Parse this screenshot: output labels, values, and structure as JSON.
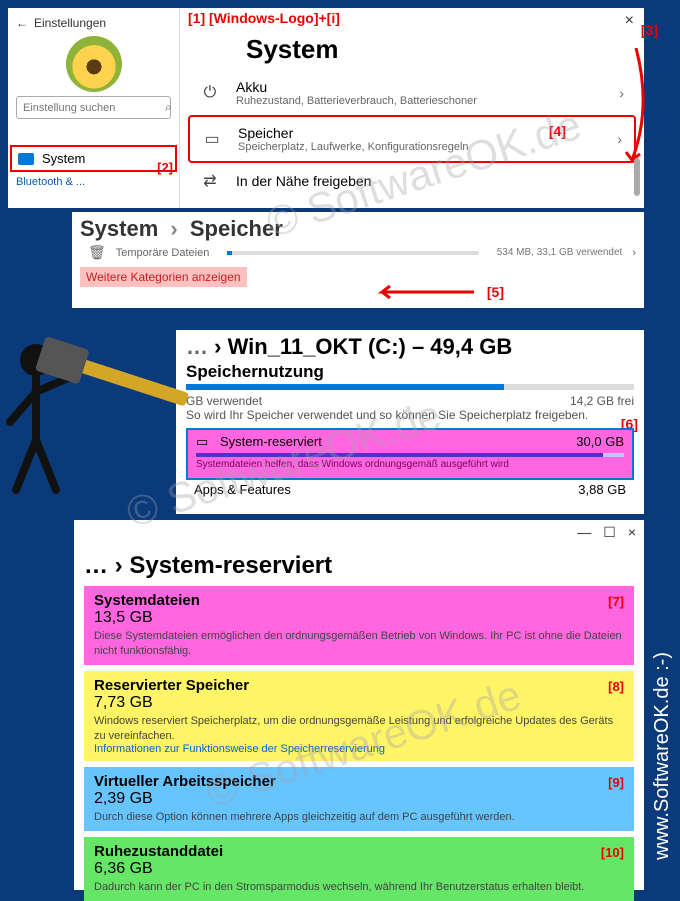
{
  "annotations": {
    "a1": "[1] [Windows-Logo]+[i]",
    "a2": "[2]",
    "a3": "[3]",
    "a4": "[4]",
    "a5": "[5]",
    "a6": "[6]",
    "a7": "[7]",
    "a8": "[8]",
    "a9": "[9]",
    "a10": "[10]"
  },
  "sidebar": {
    "back_label": "Einstellungen",
    "search_placeholder": "Einstellung suchen",
    "nav_system": "System",
    "nav_bt_stub": "Bluetooth & ..."
  },
  "main1": {
    "title": "System",
    "close": "×",
    "akku": {
      "title": "Akku",
      "subtitle": "Ruhezustand, Batterieverbrauch, Batterieschoner"
    },
    "speicher": {
      "title": "Speicher",
      "subtitle": "Speicherplatz, Laufwerke, Konfigurationsregeln"
    },
    "nearby_stub": "In der Nähe freigeben"
  },
  "panel2": {
    "crumb1": "System",
    "crumb2": "Speicher",
    "temp_label": "Temporäre Dateien",
    "temp_used": "534 MB, 33,1 GB verwendet",
    "more_categories": "Weitere Kategorien anzeigen"
  },
  "panel3": {
    "dots": "…",
    "drive_title": "Win_11_OKT (C:) – 49,4 GB",
    "sub_heading": "Speichernutzung",
    "used_label": "GB verwendet",
    "free_label": "14,2 GB frei",
    "desc": "So wird Ihr Speicher verwendet und so können Sie Speicherplatz freigeben.",
    "sysres": {
      "title": "System-reserviert",
      "size": "30,0 GB",
      "sub": "Systemdateien helfen, dass Windows ordnungsgemäß ausgeführt wird"
    },
    "apps": {
      "title": "Apps & Features",
      "size": "3,88 GB"
    }
  },
  "panel4": {
    "dots": "…",
    "title": "System-reserviert",
    "cards": [
      {
        "title": "Systemdateien",
        "size": "13,5 GB",
        "desc": "Diese Systemdateien ermöglichen den ordnungsgemäßen Betrieb von Windows. Ihr PC ist ohne die Dateien nicht funktionsfähig."
      },
      {
        "title": "Reservierter Speicher",
        "size": "7,73 GB",
        "desc": "Windows reserviert Speicherplatz, um die ordnungsgemäße Leistung und erfolgreiche Updates des Geräts zu vereinfachen.",
        "link": "Informationen zur Funktionsweise der Speicherreservierung"
      },
      {
        "title": "Virtueller Arbeitsspeicher",
        "size": "2,39 GB",
        "desc": "Durch diese Option können mehrere Apps gleichzeitig auf dem PC ausgeführt werden."
      },
      {
        "title": "Ruhezustanddatei",
        "size": "6,36 GB",
        "desc": "Dadurch kann der PC in den Stromsparmodus wechseln, während Ihr Benutzerstatus erhalten bleibt."
      }
    ]
  },
  "watermark": "© SoftwareOK.de",
  "side_url": "www.SoftwareOK.de :-)"
}
